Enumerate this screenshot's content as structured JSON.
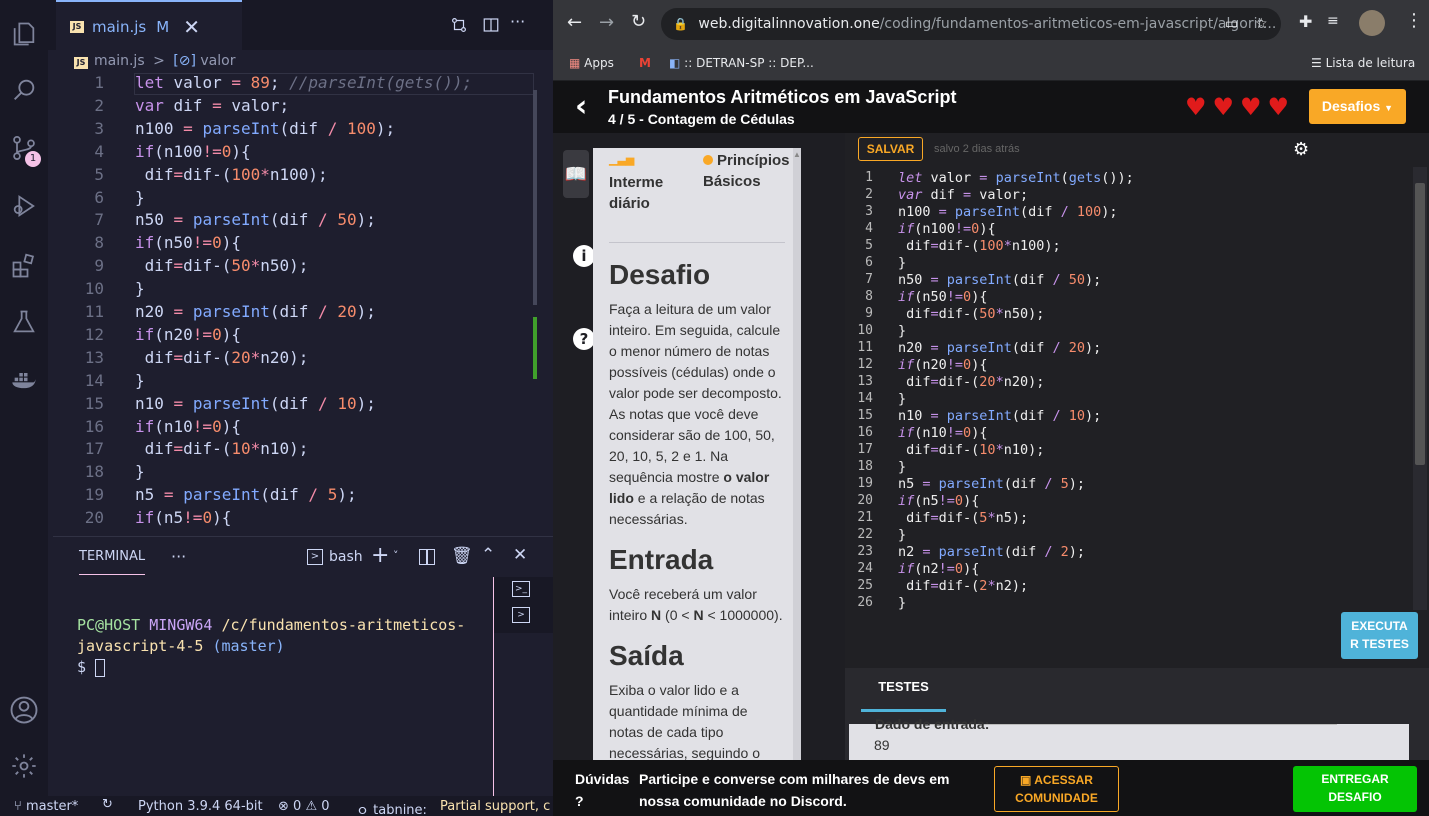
{
  "vscode": {
    "tab": {
      "icon": "JS",
      "label": "main.js",
      "modified": "M"
    },
    "breadcrumb": {
      "file": "main.js",
      "separator": ">",
      "symbol": "valor"
    },
    "line_numbers": [
      "1",
      "2",
      "3",
      "4",
      "5",
      "6",
      "7",
      "8",
      "9",
      "10",
      "11",
      "12",
      "13",
      "14",
      "15",
      "16",
      "17",
      "18",
      "19",
      "20"
    ],
    "code": [
      "let valor = 89; //parseInt(gets());",
      "var dif = valor;",
      "n100 = parseInt(dif / 100);",
      "if(n100!=0){",
      " dif=dif-(100*n100);",
      "}",
      "n50 = parseInt(dif / 50);",
      "if(n50!=0){",
      " dif=dif-(50*n50);",
      "}",
      "n20 = parseInt(dif / 20);",
      "if(n20!=0){",
      " dif=dif-(20*n20);",
      "}",
      "n10 = parseInt(dif / 10);",
      "if(n10!=0){",
      " dif=dif-(10*n10);",
      "}",
      "n5 = parseInt(dif / 5);",
      "if(n5!=0){"
    ],
    "scm_badge": "1",
    "terminal": {
      "tab": "TERMINAL",
      "more": "···",
      "shell": "bash",
      "prompt_user": "PC@HOST",
      "prompt_env": "MINGW64",
      "prompt_path": "/c/fundamentos-aritmeticos-javascript-4-5",
      "prompt_branch": "(master)",
      "prompt_symbol": "$"
    },
    "status": {
      "branch": "master*",
      "python": "Python 3.9.4 64-bit",
      "errors": "0",
      "warnings": "0",
      "tabnine": "tabnine:",
      "partial": "Partial support, c"
    }
  },
  "chrome": {
    "url_host": "web.digitalinnovation.one",
    "url_path": "/coding/fundamentos-aritmeticos-em-javascript/algorit...",
    "bookmarks": {
      "apps": "Apps",
      "detran": ":: DETRAN-SP :: DEP...",
      "reading_list": "Lista de leitura"
    }
  },
  "dio": {
    "header": {
      "title": "Fundamentos Aritméticos em JavaScript",
      "progress": "4 / 5",
      "subtitle": " - Contagem de Cédulas",
      "desafios": "Desafios"
    },
    "hearts": 4,
    "level": "Intermediário",
    "level_lines": [
      "Interme",
      "diário"
    ],
    "topic": "Princípios Básicos",
    "desafio_h": "Desafio",
    "desafio_p": "Faça a leitura de um valor inteiro. Em seguida, calcule o menor número de notas possíveis (cédulas) onde o valor pode ser decomposto. As notas que você deve considerar são de 100, 50, 20, 10, 5, 2 e 1. Na sequência mostre",
    "desafio_bold": "o valor lido",
    "desafio_p2": " e a relação de notas necessárias.",
    "entrada_h": "Entrada",
    "entrada_p1": "Você receberá um valor inteiro ",
    "entrada_n": "N",
    "entrada_p2": " (0 < ",
    "entrada_n2": "N",
    "entrada_p3": " < 1000000).",
    "saida_h": "Saída",
    "saida_p": "Exiba o valor lido e a quantidade mínima de notas de cada tipo necessárias, seguindo o exemplo de saída abaixo. Após cada linha deve",
    "salvar": "SALVAR",
    "saved": "salvo 2 dias atrás",
    "editor_lines": [
      "let valor = parseInt(gets());",
      "var dif = valor;",
      "n100 = parseInt(dif / 100);",
      "if(n100!=0){",
      " dif=dif-(100*n100);",
      "}",
      "n50 = parseInt(dif / 50);",
      "if(n50!=0){",
      " dif=dif-(50*n50);",
      "}",
      "n20 = parseInt(dif / 20);",
      "if(n20!=0){",
      " dif=dif-(20*n20);",
      "}",
      "n10 = parseInt(dif / 10);",
      "if(n10!=0){",
      " dif=dif-(10*n10);",
      "}",
      "n5 = parseInt(dif / 5);",
      "if(n5!=0){",
      " dif=dif-(5*n5);",
      "}",
      "n2 = parseInt(dif / 2);",
      "if(n2!=0){",
      " dif=dif-(2*n2);",
      "}"
    ],
    "tests_tab": "TESTES",
    "run_tests": "EXECUTAR TESTES",
    "run_tests_lines": [
      "EXECUTA",
      "R TESTES"
    ],
    "input_label": "Dado de entrada:",
    "input_value": "89",
    "footer": {
      "duvidas": "Dúvidas ?",
      "duvidas_lines": [
        "Dúvidas",
        "?"
      ],
      "text": "Participe e converse com milhares de devs em nossa comunidade no Discord.",
      "text_lines": [
        "Participe e converse com milhares de devs em",
        "nossa comunidade no Discord."
      ],
      "acessar": "ACESSAR COMUNIDADE",
      "acessar_lines": [
        "ACESSAR",
        "COMUNIDADE"
      ],
      "entregar": "ENTREGAR DESAFIO",
      "entregar_lines": [
        "ENTREGAR",
        "DESAFIO"
      ]
    }
  }
}
